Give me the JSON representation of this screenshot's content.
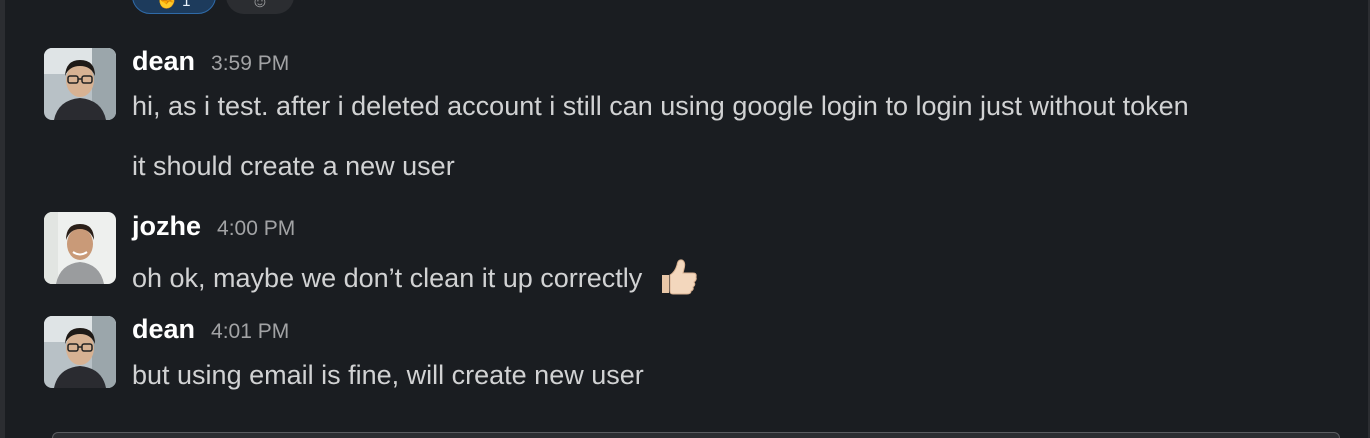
{
  "reactions": {
    "count": "1"
  },
  "messages": [
    {
      "author": "dean",
      "time": "3:59 PM",
      "lines": [
        "hi, as i test. after i deleted account i still can using google login to login just without token",
        "it should create a new user"
      ]
    },
    {
      "author": "jozhe",
      "time": "4:00 PM",
      "lines": [
        "oh ok, maybe we don’t clean it up correctly"
      ],
      "emoji": "thumbs-up-icon"
    },
    {
      "author": "dean",
      "time": "4:01 PM",
      "lines": [
        "but using email is fine, will create new user"
      ]
    }
  ]
}
